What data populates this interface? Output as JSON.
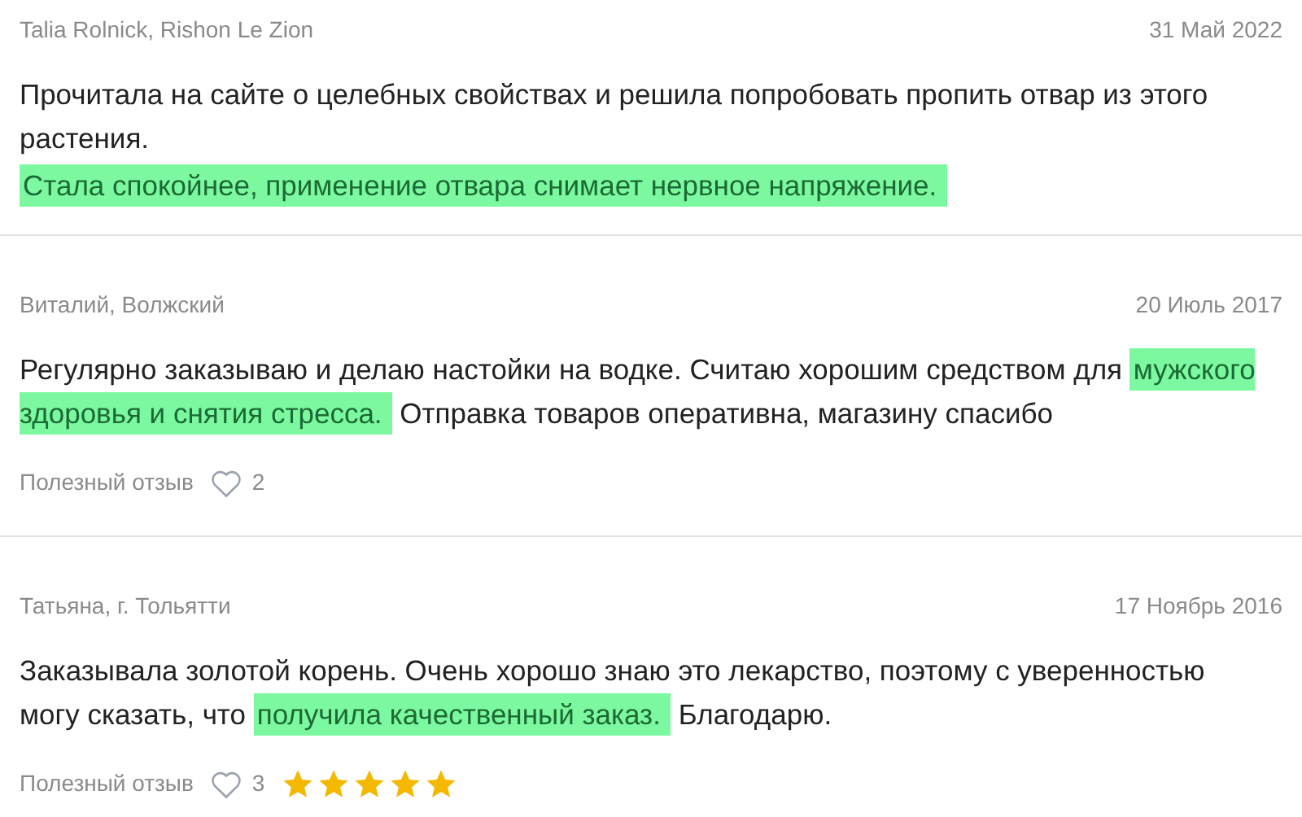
{
  "reviews": [
    {
      "author": "Talia Rolnick, Rishon Le Zion",
      "date": "31 Май 2022",
      "paragraphs": [
        [
          {
            "text": "Прочитала на сайте о целебных свойствах и решила попробовать пропить отвар из этого растения.",
            "highlighted": false
          }
        ],
        [
          {
            "text": "Стала спокойнее, применение отвара снимает нервное напряжение.",
            "highlighted": true
          }
        ]
      ]
    },
    {
      "author": "Виталий, Волжский",
      "date": "20 Июль 2017",
      "paragraphs": [
        [
          {
            "text": "Регулярно заказываю и делаю настойки на водке. Считаю хорошим средством для ",
            "highlighted": false
          },
          {
            "text": "мужского здоровья и снятия стресса.",
            "highlighted": true
          },
          {
            "text": " Отправка товаров оперативна, магазину спасибо",
            "highlighted": false
          }
        ]
      ],
      "helpful_label": "Полезный отзыв",
      "likes": "2"
    },
    {
      "author": "Татьяна, г. Тольятти",
      "date": "17 Ноябрь 2016",
      "paragraphs": [
        [
          {
            "text": "Заказывала золотой корень. Очень хорошо знаю это лекарство, поэтому с уверенностью могу сказать, что ",
            "highlighted": false
          },
          {
            "text": "получила качественный заказ.",
            "highlighted": true
          },
          {
            "text": " Благодарю.",
            "highlighted": false
          }
        ]
      ],
      "helpful_label": "Полезный отзыв",
      "likes": "3",
      "stars": 5
    }
  ]
}
